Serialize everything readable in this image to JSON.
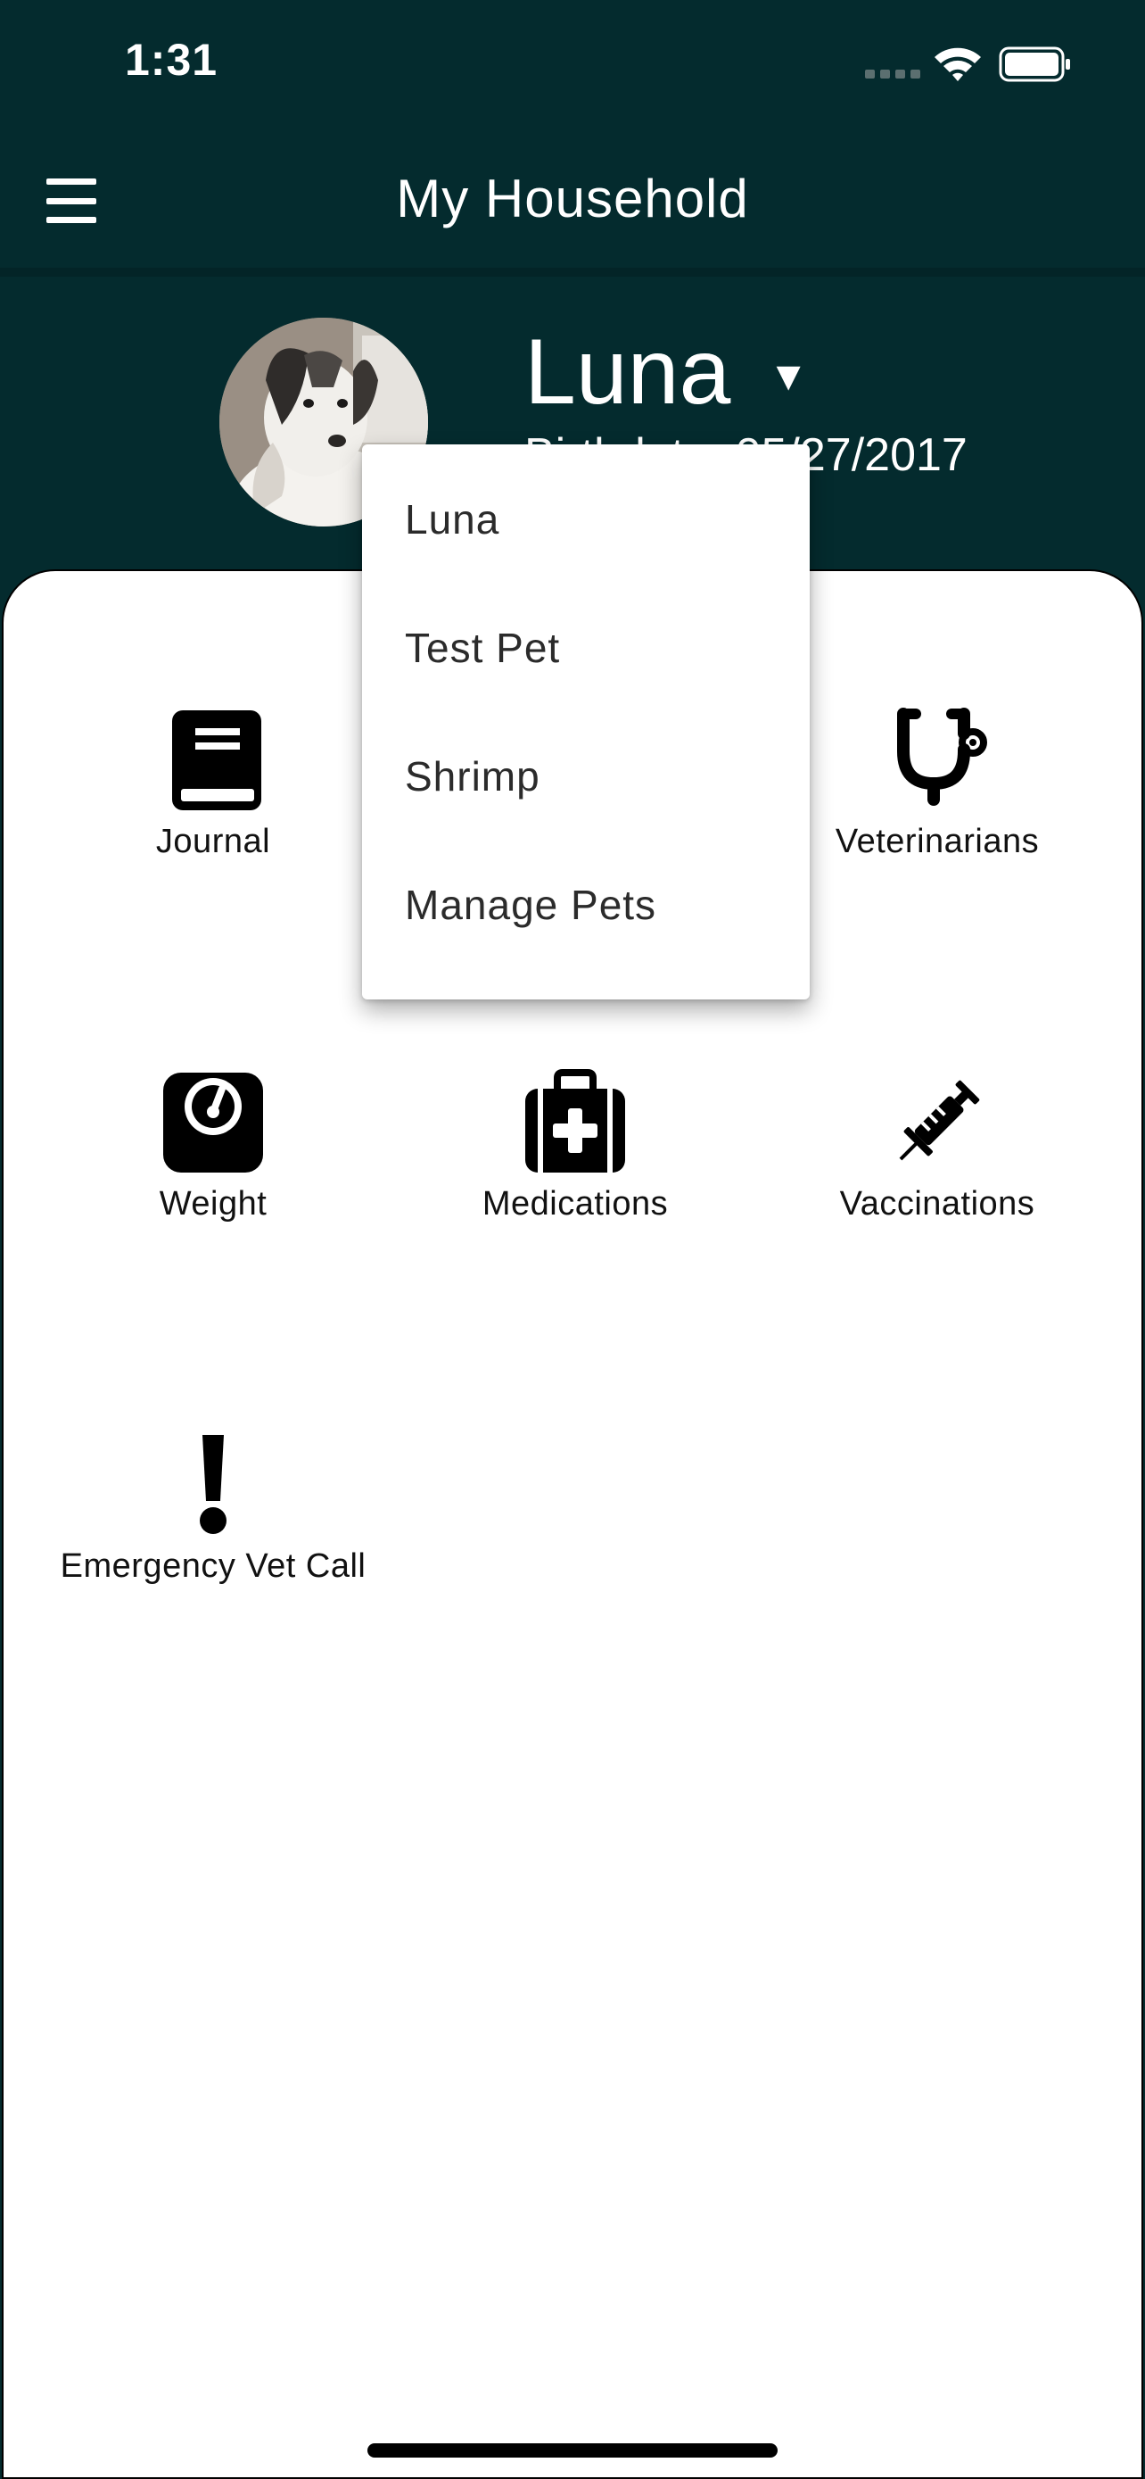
{
  "status_bar": {
    "time": "1:31",
    "signal_icon": "cellular-signal-icon",
    "wifi_icon": "wifi-icon",
    "battery_icon": "battery-full-icon"
  },
  "header": {
    "menu_icon": "hamburger-menu-icon",
    "title": "My Household"
  },
  "pet": {
    "name": "Luna",
    "birthdate_label": "Birthdate:",
    "birthdate": "05/27/2017"
  },
  "tiles": [
    {
      "label": "Journal",
      "icon": "book-icon"
    },
    {
      "label": "Veterinarians",
      "icon": "stethoscope-icon"
    },
    {
      "label": "Weight",
      "icon": "scale-icon"
    },
    {
      "label": "Medications",
      "icon": "first-aid-kit-icon"
    },
    {
      "label": "Vaccinations",
      "icon": "syringe-icon"
    },
    {
      "label": "Emergency Vet Call",
      "icon": "exclamation-icon"
    }
  ],
  "dropdown": {
    "items": [
      {
        "label": "Luna"
      },
      {
        "label": "Test Pet"
      },
      {
        "label": "Shrimp"
      },
      {
        "label": "Manage Pets"
      }
    ]
  },
  "colors": {
    "header_bg": "#042b2e",
    "card_bg": "#ffffff",
    "icon_color": "#000000"
  }
}
